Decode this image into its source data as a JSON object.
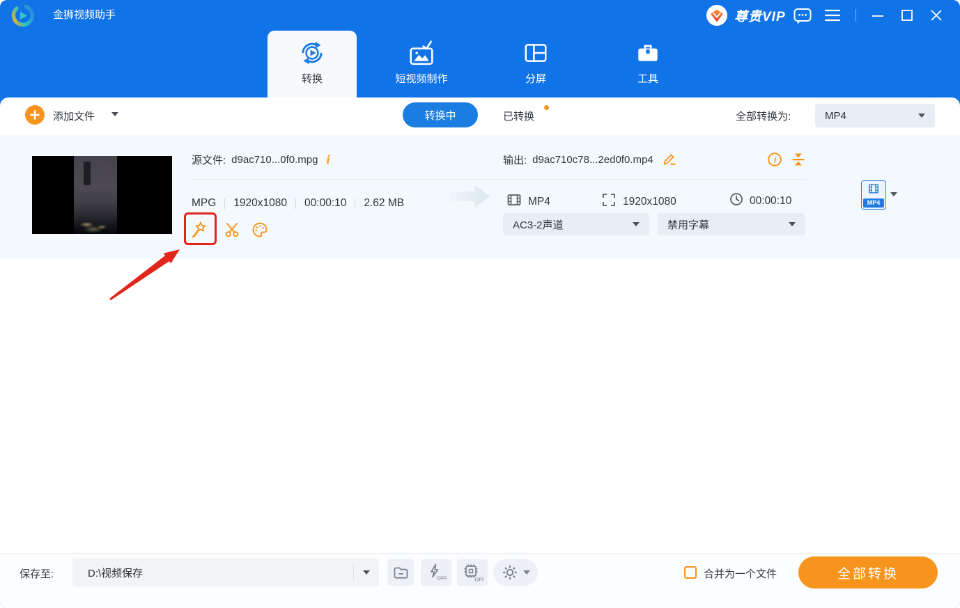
{
  "titlebar": {
    "app_title": "金狮视频助手",
    "vip_label": "尊贵VIP"
  },
  "nav": {
    "tabs": [
      {
        "label": "转换",
        "active": true
      },
      {
        "label": "短视频制作",
        "active": false
      },
      {
        "label": "分屏",
        "active": false
      },
      {
        "label": "工具",
        "active": false
      }
    ]
  },
  "toolbar": {
    "add_file": "添加文件",
    "converting_tab": "转换中",
    "converted_tab": "已转换",
    "convert_all_label": "全部转换为:",
    "format_value": "MP4"
  },
  "file": {
    "source_label": "源文件:",
    "source_name": "d9ac710...0f0.mpg",
    "meta": {
      "format": "MPG",
      "resolution": "1920x1080",
      "duration": "00:00:10",
      "size": "2.62 MB"
    },
    "output_label": "输出:",
    "output_name": "d9ac710c78...2ed0f0.mp4",
    "out_meta": {
      "format": "MP4",
      "resolution": "1920x1080",
      "duration": "00:00:10"
    },
    "audio_option": "AC3-2声道",
    "subtitle_option": "禁用字幕",
    "format_badge": "MP4"
  },
  "bottombar": {
    "save_label": "保存至:",
    "save_path": "D:\\视频保存",
    "hw_off": "OFF",
    "gpu_off": "OFF",
    "merge_label": "合并为一个文件",
    "convert_all_button": "全部转换"
  },
  "icons": {
    "info_glyph": "i"
  },
  "colors": {
    "titlebar_blue": "#1173e8",
    "accent_orange": "#f7941e",
    "pill_blue": "#1b7ce2",
    "annotation_red": "#e2261c",
    "panel_bg": "#ffffff",
    "file_row_bg": "#f4f9fd"
  }
}
